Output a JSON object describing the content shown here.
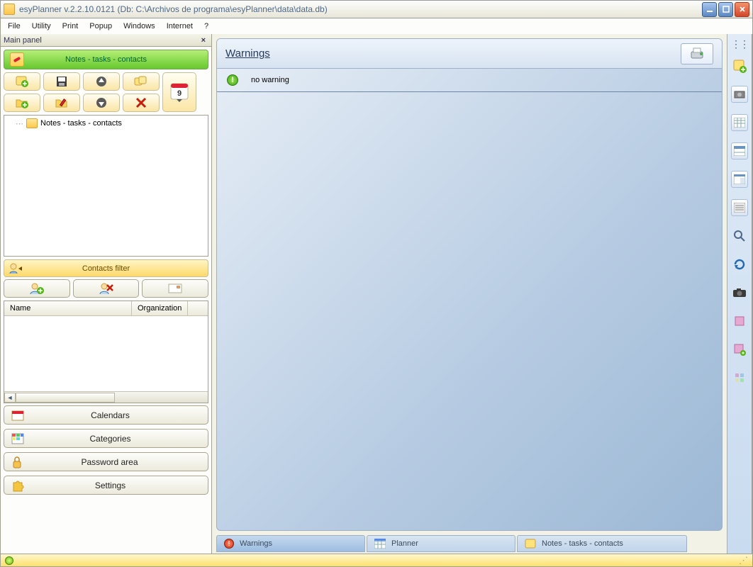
{
  "window": {
    "title": "esyPlanner v.2.2.10.0121 (Db: C:\\Archivos de programa\\esyPlanner\\data\\data.db)"
  },
  "menu": {
    "file": "File",
    "utility": "Utility",
    "print": "Print",
    "popup": "Popup",
    "windows": "Windows",
    "internet": "Internet",
    "help": "?"
  },
  "mainpanel": {
    "header": "Main panel",
    "notes_section": "Notes - tasks - contacts",
    "tree_root": "Notes - tasks - contacts",
    "contacts_filter": "Contacts filter",
    "grid": {
      "col_name": "Name",
      "col_org": "Organization"
    },
    "nav": {
      "calendars": "Calendars",
      "categories": "Categories",
      "password": "Password area",
      "settings": "Settings"
    }
  },
  "warnings": {
    "title": "Warnings",
    "no_warning": "no warning"
  },
  "tabs": {
    "warnings": "Warnings",
    "planner": "Planner",
    "notes": "Notes - tasks - contacts"
  }
}
